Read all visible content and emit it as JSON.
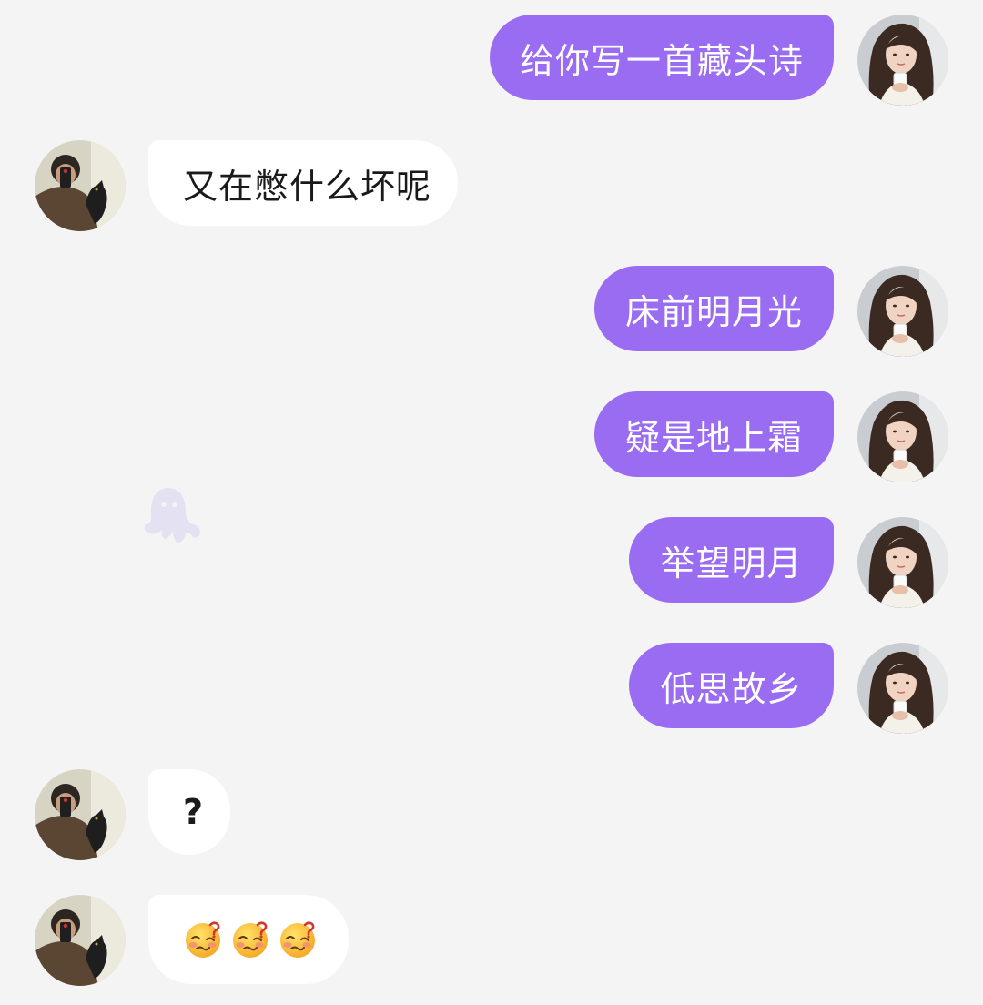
{
  "conversation": {
    "messages": [
      {
        "sender": "me",
        "text": "给你写一首藏头诗"
      },
      {
        "sender": "them",
        "text": "又在憋什么坏呢"
      },
      {
        "sender": "me",
        "text": "床前明月光"
      },
      {
        "sender": "me",
        "text": "疑是地上霜"
      },
      {
        "sender": "me",
        "text": "举望明月"
      },
      {
        "sender": "me",
        "text": "低思故乡"
      },
      {
        "sender": "them",
        "text": "?"
      },
      {
        "sender": "them",
        "emoji": [
          "woozy-face",
          "woozy-face",
          "woozy-face"
        ]
      }
    ]
  },
  "colors": {
    "background": "#f4f4f5",
    "my_bubble": "#9a6cf2",
    "their_bubble": "#ffffff",
    "my_text": "#ffffff",
    "their_text": "#1a1a1a"
  },
  "icons": {
    "watermark": "octopus-logo",
    "their_avatar": "user-photo-with-cat",
    "my_avatar": "user-photo-woman"
  }
}
